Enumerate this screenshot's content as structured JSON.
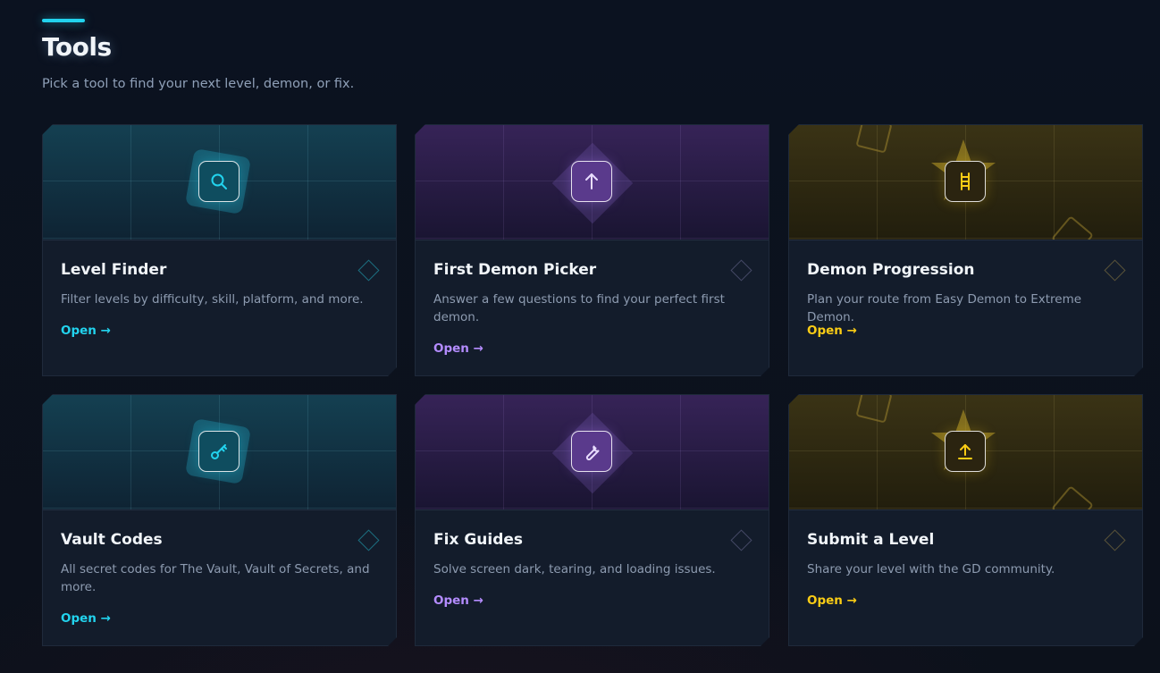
{
  "header": {
    "title": "Tools",
    "subtitle": "Pick a tool to find your next level, demon, or fix.",
    "accent_color": "#22d3ee"
  },
  "cards": [
    {
      "title": "Level Finder",
      "description": "Filter levels by difficulty, skill, platform, and more.",
      "link_label": "Open →",
      "icon": "search-icon",
      "theme": "cyan",
      "accent": "#22d3ee"
    },
    {
      "title": "First Demon Picker",
      "description": "Answer a few questions to find your perfect first demon.",
      "link_label": "Open →",
      "icon": "arrow-up-icon",
      "theme": "purple",
      "accent": "#b48cff"
    },
    {
      "title": "Demon Progression",
      "description": "Plan your route from Easy Demon to Extreme Demon.",
      "link_label": "Open →",
      "icon": "ladder-icon",
      "theme": "gold",
      "accent": "#facc15"
    },
    {
      "title": "Vault Codes",
      "description": "All secret codes for The Vault, Vault of Secrets, and more.",
      "link_label": "Open →",
      "icon": "key-icon",
      "theme": "cyan",
      "accent": "#22d3ee"
    },
    {
      "title": "Fix Guides",
      "description": "Solve screen dark, tearing, and loading issues.",
      "link_label": "Open →",
      "icon": "wrench-icon",
      "theme": "purple",
      "accent": "#b48cff"
    },
    {
      "title": "Submit a Level",
      "description": "Share your level with the GD community.",
      "link_label": "Open →",
      "icon": "upload-icon",
      "theme": "gold",
      "accent": "#facc15"
    }
  ]
}
